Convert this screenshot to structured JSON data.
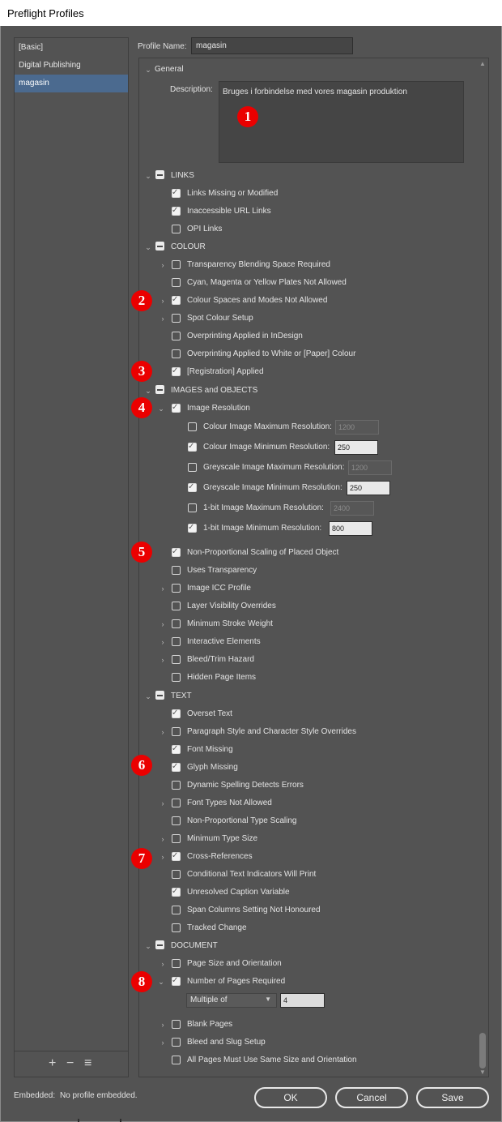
{
  "window": {
    "title": "Preflight Profiles"
  },
  "profiles": [
    "[Basic]",
    "Digital Publishing",
    "magasin"
  ],
  "profile_toolbar": {
    "add": "+",
    "remove": "−",
    "menu": "≡"
  },
  "profile_name": {
    "label": "Profile Name:",
    "value": "magasin"
  },
  "general": {
    "heading": "General",
    "description_label": "Description:",
    "description_value": "Bruges i forbindelse med vores magasin produktion"
  },
  "sections": {
    "links": "LINKS",
    "colour": "COLOUR",
    "images": "IMAGES and OBJECTS",
    "text": "TEXT",
    "document": "DOCUMENT"
  },
  "rows": {
    "links_missing": "Links Missing or Modified",
    "inaccessible_url": "Inaccessible URL Links",
    "opi_links": "OPI Links",
    "transparency_blending": "Transparency Blending Space Required",
    "cmy_plates": "Cyan, Magenta or Yellow Plates Not Allowed",
    "colour_spaces": "Colour Spaces and Modes Not Allowed",
    "spot_colour": "Spot Colour Setup",
    "overprint_indesign": "Overprinting Applied in InDesign",
    "overprint_white": "Overprinting Applied to White or [Paper] Colour",
    "registration": "[Registration] Applied",
    "image_resolution": "Image Resolution",
    "colour_max": "Colour Image Maximum Resolution:",
    "colour_min": "Colour Image Minimum Resolution:",
    "grey_max": "Greyscale Image Maximum Resolution:",
    "grey_min": "Greyscale Image Minimum Resolution:",
    "bit_max": "1-bit Image Maximum Resolution:",
    "bit_min": "1-bit Image Minimum Resolution:",
    "non_prop_scaling": "Non-Proportional Scaling of Placed Object",
    "uses_transparency": "Uses Transparency",
    "image_icc": "Image ICC Profile",
    "layer_visibility": "Layer Visibility Overrides",
    "min_stroke": "Minimum Stroke Weight",
    "interactive": "Interactive Elements",
    "bleed_trim": "Bleed/Trim Hazard",
    "hidden_page": "Hidden Page Items",
    "overset": "Overset Text",
    "para_style": "Paragraph Style and Character Style Overrides",
    "font_missing": "Font Missing",
    "glyph_missing": "Glyph Missing",
    "dynamic_spelling": "Dynamic Spelling Detects Errors",
    "font_types": "Font Types Not Allowed",
    "non_prop_type": "Non-Proportional Type Scaling",
    "min_type": "Minimum Type Size",
    "cross_refs": "Cross-References",
    "conditional_text": "Conditional Text Indicators Will Print",
    "unresolved_caption": "Unresolved Caption Variable",
    "span_columns": "Span Columns Setting Not Honoured",
    "tracked_change": "Tracked Change",
    "page_size": "Page Size and Orientation",
    "num_pages": "Number of Pages Required",
    "blank_pages": "Blank Pages",
    "bleed_slug": "Bleed and Slug Setup",
    "same_size": "All Pages Must Use Same Size and Orientation"
  },
  "values": {
    "colour_max": "1200",
    "colour_min": "250",
    "grey_max": "1200",
    "grey_min": "250",
    "bit_max": "2400",
    "bit_min": "800",
    "pages_mode": "Multiple of",
    "pages_count": "4"
  },
  "badges": [
    "1",
    "2",
    "3",
    "4",
    "5",
    "6",
    "7",
    "8"
  ],
  "footer": {
    "embedded_label": "Embedded:",
    "embedded_value": "No profile embedded.",
    "ok": "OK",
    "cancel": "Cancel",
    "save": "Save"
  },
  "colors": {
    "selection": "#4b6a8f",
    "badge": "#ea0000",
    "panel": "#535353"
  }
}
